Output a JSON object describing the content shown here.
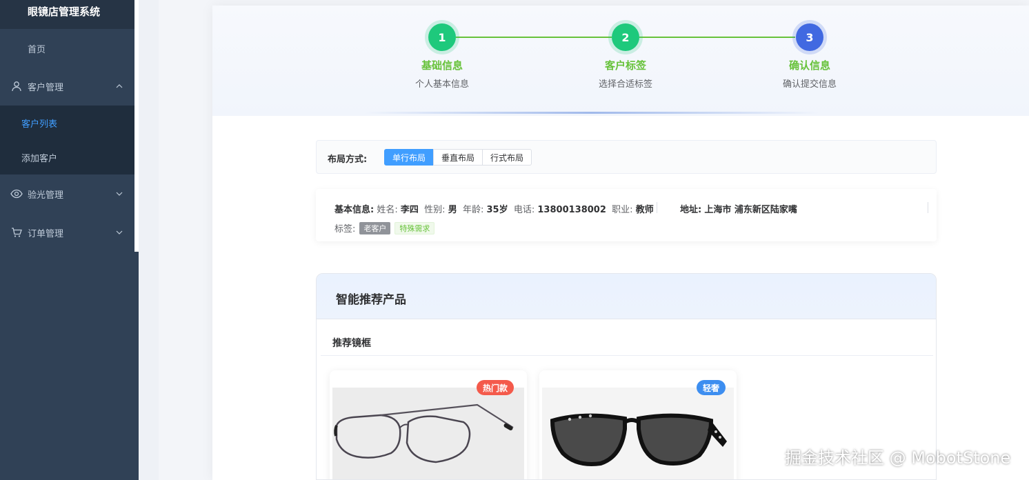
{
  "app": {
    "title": "眼镜店管理系统"
  },
  "sidebar": {
    "home": "首页",
    "customer": "客户管理",
    "customer_list": "客户列表",
    "add_customer": "添加客户",
    "optometry": "验光管理",
    "orders": "订单管理"
  },
  "steps": [
    {
      "number": "1",
      "title": "基础信息",
      "desc": "个人基本信息",
      "status": "done"
    },
    {
      "number": "2",
      "title": "客户标签",
      "desc": "选择合适标签",
      "status": "done"
    },
    {
      "number": "3",
      "title": "确认信息",
      "desc": "确认提交信息",
      "status": "current"
    }
  ],
  "layout": {
    "label": "布局方式:",
    "options": [
      "单行布局",
      "垂直布局",
      "行式布局"
    ],
    "selected": "单行布局"
  },
  "info": {
    "basic_label": "基本信息:",
    "name_key": "姓名:",
    "name": "李四",
    "gender_key": "性别:",
    "gender": "男",
    "age_key": "年龄:",
    "age": "35岁",
    "phone_key": "电话:",
    "phone": "13800138002",
    "job_key": "职业:",
    "job": "教师",
    "address_key": "地址:",
    "address": "上海市 浦东新区陆家嘴",
    "tags_key": "标签:",
    "tags": [
      "老客户",
      "特殊需求"
    ]
  },
  "recommend": {
    "title": "智能推荐产品",
    "section": "推荐镜框",
    "products": [
      {
        "badge": "热门款",
        "badge_color": "#f45a4b"
      },
      {
        "badge": "轻奢",
        "badge_color": "#3d8ef0"
      }
    ]
  },
  "watermark": "掘金技术社区 @ MobotStone",
  "colors": {
    "sidebar": "#304156",
    "active": "#409eff",
    "success": "#1ec97c",
    "current": "#4169e1"
  }
}
